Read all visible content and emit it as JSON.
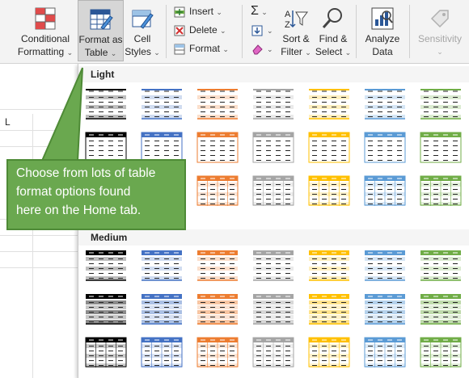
{
  "ribbon": {
    "conditional_formatting": {
      "line1": "Conditional",
      "line2": "Formatting",
      "caret": "⌄"
    },
    "format_as_table": {
      "line1": "Format as",
      "line2": "Table",
      "caret": "⌄"
    },
    "cell_styles": {
      "line1": "Cell",
      "line2": "Styles",
      "caret": "⌄"
    },
    "insert": {
      "label": "Insert",
      "caret": "⌄"
    },
    "delete": {
      "label": "Delete",
      "caret": "⌄"
    },
    "format": {
      "label": "Format",
      "caret": "⌄"
    },
    "autosum_caret": "⌄",
    "fill_caret": "⌄",
    "clear_caret": "⌄",
    "sort_filter": {
      "line1": "Sort &",
      "line2": "Filter",
      "caret": "⌄"
    },
    "find_select": {
      "line1": "Find &",
      "line2": "Select",
      "caret": "⌄"
    },
    "analyze_data": {
      "line1": "Analyze",
      "line2": "Data"
    },
    "sensitivity": {
      "line1": "Sensitivity",
      "caret": "⌄"
    }
  },
  "sheet": {
    "column_header": "L"
  },
  "gallery": {
    "sections": [
      {
        "label": "Light"
      },
      {
        "label": "Medium"
      }
    ],
    "theme_colors": [
      "#000000",
      "#4472c4",
      "#ed7d31",
      "#a5a5a5",
      "#ffc000",
      "#5b9bd5",
      "#70ad47"
    ]
  },
  "callout": {
    "line1": "Choose from lots of table",
    "line2": "format options found",
    "line3": "here on the Home tab."
  }
}
